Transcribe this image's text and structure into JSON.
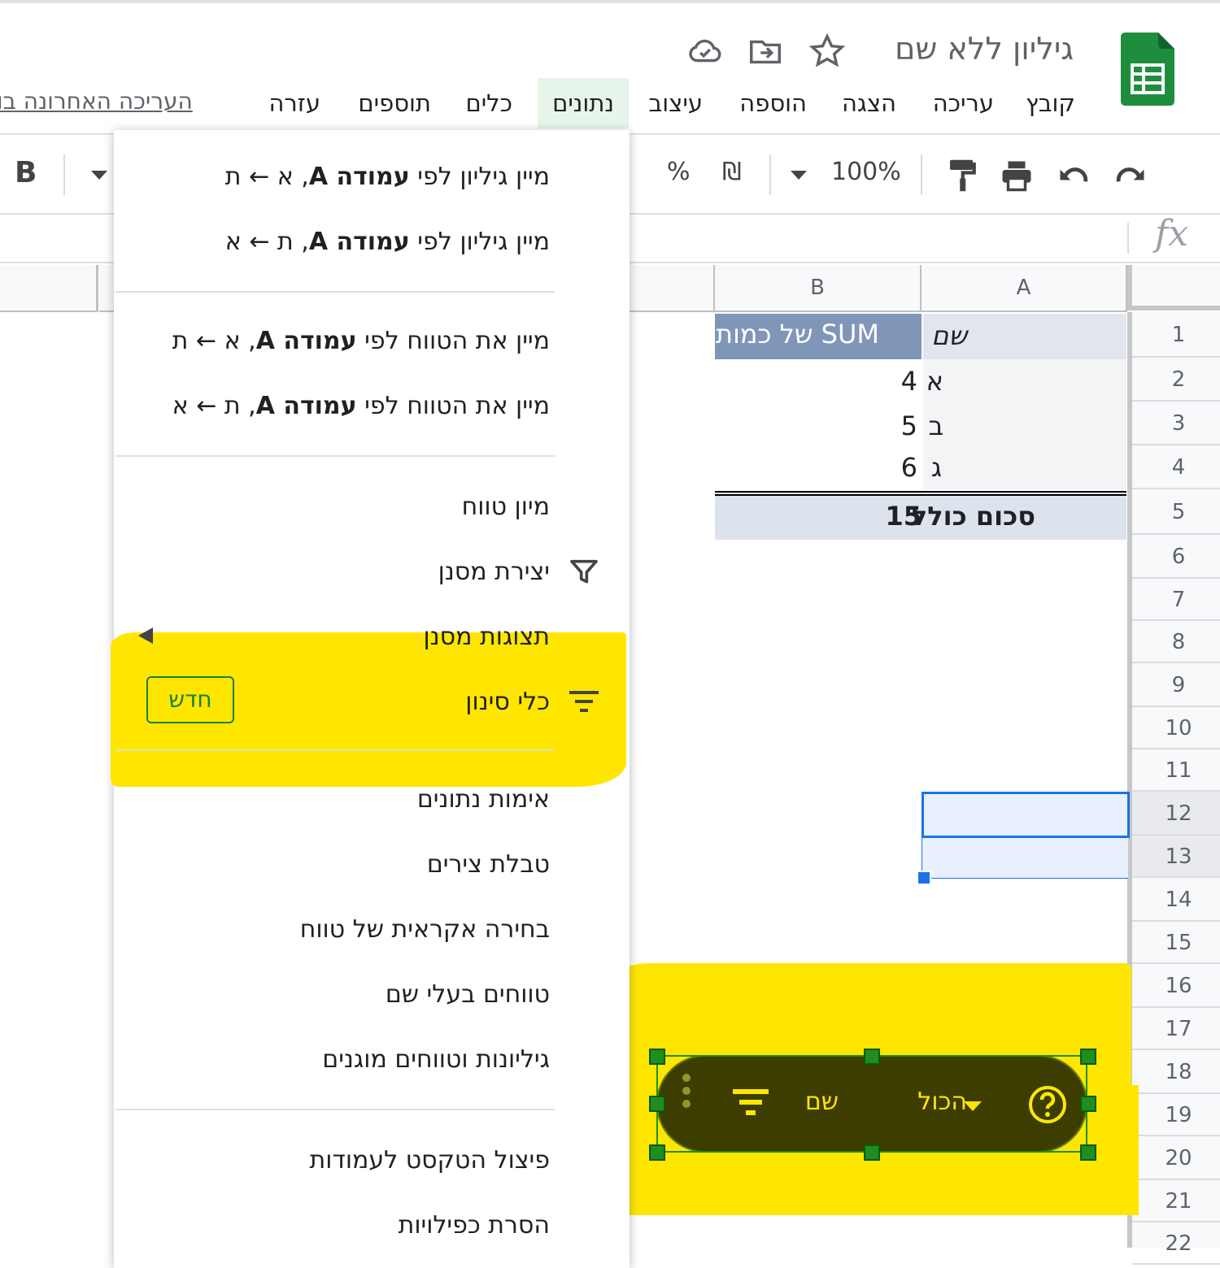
{
  "header": {
    "doc_title": "גיליון ללא שם",
    "last_edit": "העריכה האחרונה בו"
  },
  "menu": {
    "file": "קובץ",
    "edit": "עריכה",
    "view": "הצגה",
    "insert": "הוספה",
    "format": "עיצוב",
    "data": "נתונים",
    "tools": "כלים",
    "addons": "תוספים",
    "help": "עזרה"
  },
  "toolbar": {
    "zoom": "100%",
    "currency": "₪",
    "percent": "%",
    "bold": "B"
  },
  "formula_bar": {
    "fx": "fx"
  },
  "grid": {
    "columns": [
      "A",
      "B"
    ],
    "rows": [
      "1",
      "2",
      "3",
      "4",
      "5",
      "6",
      "7",
      "8",
      "9",
      "10",
      "11",
      "12",
      "13",
      "14",
      "15",
      "16",
      "17",
      "18",
      "19",
      "20",
      "21",
      "22"
    ],
    "pivot": {
      "header_a": "שם",
      "header_b": "SUM של כמות",
      "rows": [
        {
          "name": "א",
          "value": "4"
        },
        {
          "name": "ב",
          "value": "5"
        },
        {
          "name": "ג",
          "value": "6"
        }
      ],
      "total_label": "סכום כולל",
      "total_value": "15"
    }
  },
  "data_menu": {
    "sort_sheet_az_prefix": "מיין גיליון לפי",
    "sort_sheet_az_bold": "עמודה A",
    "sort_sheet_az_suffix": ", א ← ת",
    "sort_sheet_za_prefix": "מיין גיליון לפי",
    "sort_sheet_za_bold": "עמודה A",
    "sort_sheet_za_suffix": ", ת ← א",
    "sort_range_az_prefix": "מיין את הטווח לפי",
    "sort_range_az_bold": "עמודה A",
    "sort_range_az_suffix": ", א ← ת",
    "sort_range_za_prefix": "מיין את הטווח לפי",
    "sort_range_za_bold": "עמודה A",
    "sort_range_za_suffix": ", ת ← א",
    "sort_range": "מיון טווח",
    "create_filter": "יצירת מסנן",
    "filter_views": "תצוגות מסנן",
    "slicer": "כלי סינון",
    "new_badge": "חדש",
    "data_validation": "אימות נתונים",
    "pivot_table": "טבלת צירים",
    "randomize_range": "בחירה אקראית של טווח",
    "named_ranges": "טווחים בעלי שם",
    "protected_sheets": "גיליונות וטווחים מוגנים",
    "split_text": "פיצול הטקסט לעמודות",
    "remove_duplicates": "הסרת כפילויות"
  },
  "slicer_chip": {
    "column": "שם",
    "value": "הכול"
  },
  "colors": {
    "highlight": "#ffe600",
    "selection": "#1a73e8",
    "pivot_header": "#8096b8",
    "chip_bg": "#3d3d00",
    "active_menu": "#e6f4ea"
  }
}
